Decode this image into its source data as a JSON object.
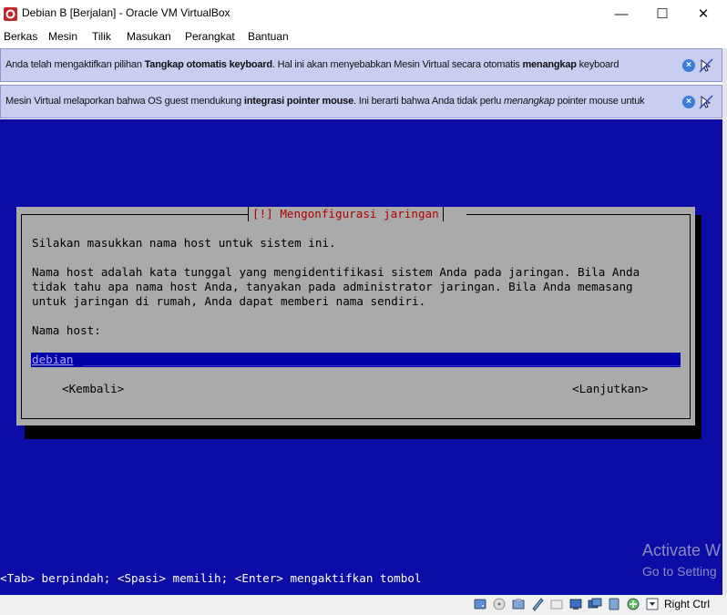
{
  "window": {
    "title": "Debian B [Berjalan] - Oracle VM VirtualBox",
    "min_glyph": "—",
    "max_glyph": "☐",
    "close_glyph": "✕"
  },
  "menu": {
    "items": [
      "Berkas",
      "Mesin",
      "Tilik",
      "Masukan",
      "Perangkat",
      "Bantuan"
    ]
  },
  "banners": [
    {
      "pre": "Anda telah mengaktifkan pilihan ",
      "bold1": "Tangkap otomatis keyboard",
      "mid": ". Hal ini akan menyebabkan Mesin Virtual secara otomatis ",
      "bold2": "menangkap",
      "post": " keyboard"
    },
    {
      "pre": "Mesin Virtual melaporkan bahwa OS guest mendukung ",
      "bold1": "integrasi pointer mouse",
      "mid": ". Ini berarti bahwa Anda tidak perlu ",
      "italic": "menangkap",
      "post": " pointer mouse untuk"
    }
  ],
  "installer": {
    "title": "[!] Mengonfigurasi jaringan",
    "prompt": "Silakan masukkan nama host untuk sistem ini.",
    "desc1": "Nama host adalah kata tunggal yang mengidentifikasi sistem Anda pada jaringan. Bila Anda",
    "desc2": "tidak tahu apa nama host Anda, tanyakan pada administrator jaringan. Bila Anda memasang",
    "desc3": "untuk jaringan di rumah, Anda dapat memberi nama sendiri.",
    "field_label": "Nama host:",
    "hostname_value": "debian",
    "back_button": "<Kembali>",
    "next_button": "<Lanjutkan>",
    "help_line": "<Tab> berpindah; <Spasi> memilih; <Enter> mengaktifkan tombol"
  },
  "watermark": {
    "line1": "Activate W",
    "line2": "Go to Setting"
  },
  "statusbar": {
    "host_key": "Right Ctrl",
    "icons": [
      "hard-disk-icon",
      "optical-drive-icon",
      "audio-icon",
      "network-icon",
      "usb-icon",
      "shared-folders-icon",
      "display-icon",
      "recording-icon",
      "cpu-icon",
      "mouse-integration-icon",
      "keyboard-capture-icon"
    ]
  },
  "colors": {
    "vm_background": "#0c0ca6",
    "dialog_background": "#aaaaaa",
    "dialog_title": "#b00000",
    "banner_background": "#c9cdf0"
  }
}
